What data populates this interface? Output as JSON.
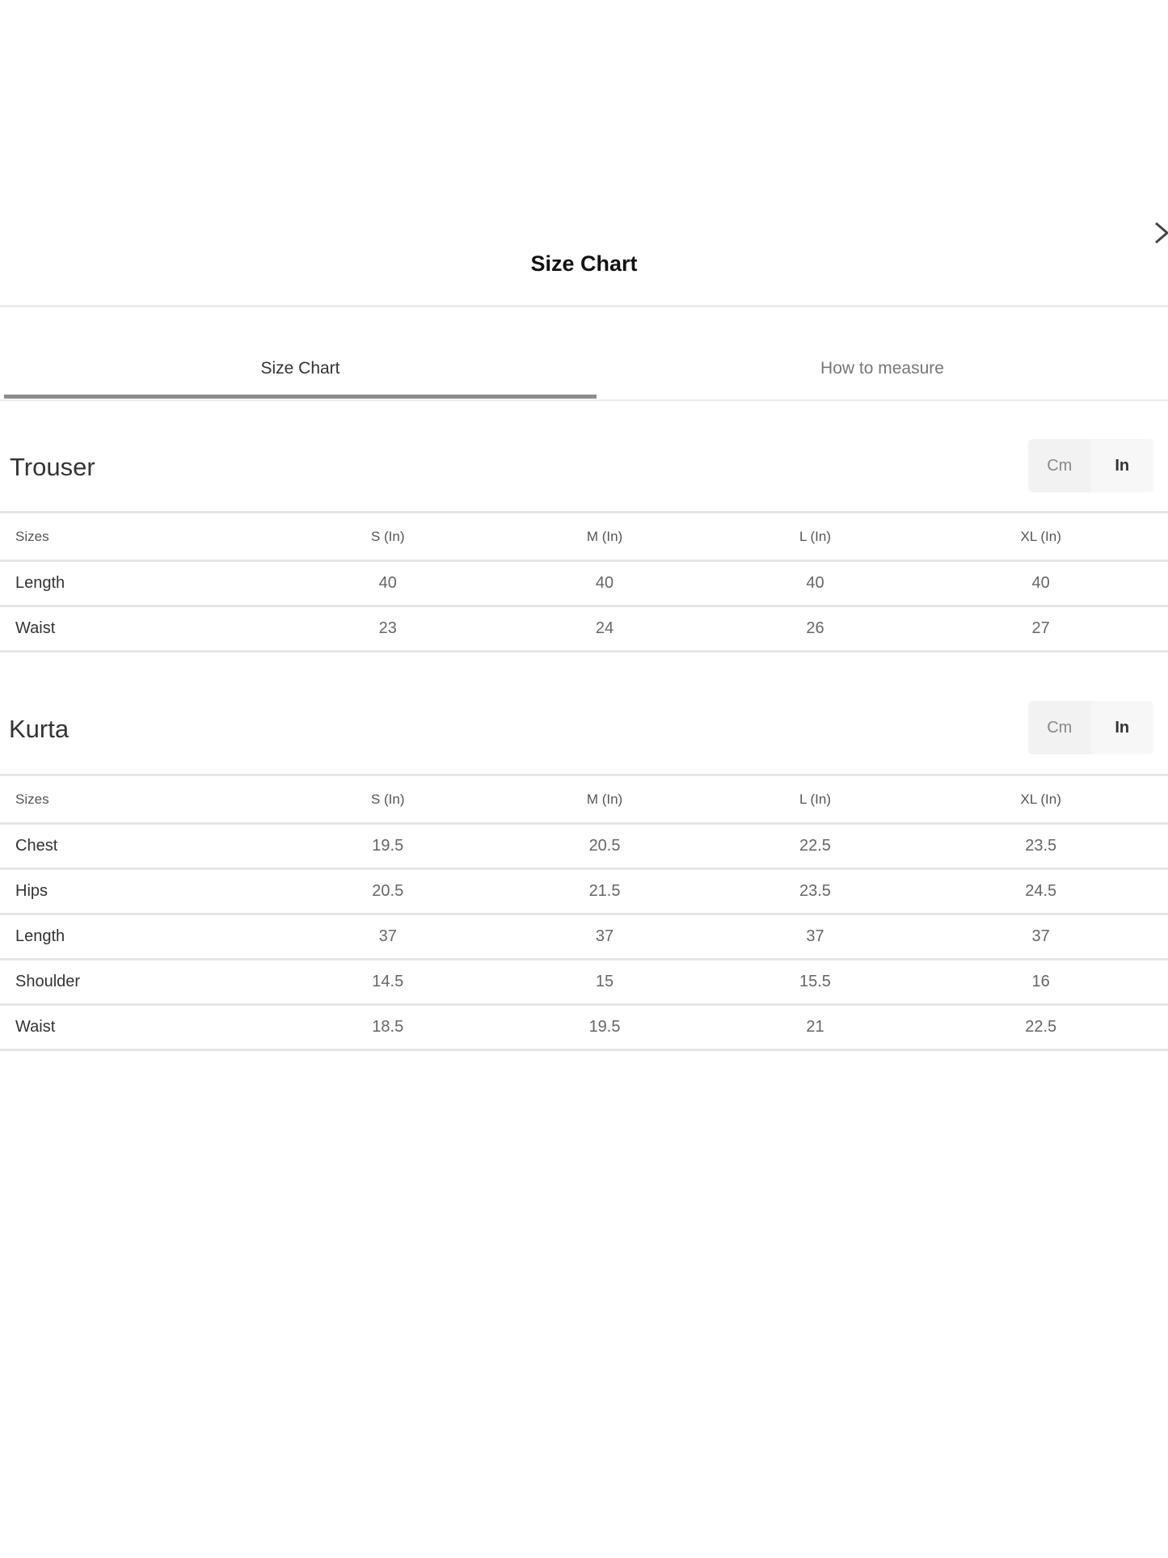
{
  "modal": {
    "title": "Size Chart"
  },
  "tabs": [
    {
      "label": "Size Chart",
      "active": true
    },
    {
      "label": "How to measure",
      "active": false
    }
  ],
  "units": {
    "cm": "Cm",
    "in": "In",
    "selected": "In"
  },
  "sections": [
    {
      "title": "Trouser",
      "headers": [
        "Sizes",
        "S (In)",
        "M (In)",
        "L (In)",
        "XL (In)"
      ],
      "rows": [
        {
          "label": "Length",
          "values": [
            "40",
            "40",
            "40",
            "40"
          ]
        },
        {
          "label": "Waist",
          "values": [
            "23",
            "24",
            "26",
            "27"
          ]
        }
      ]
    },
    {
      "title": "Kurta",
      "headers": [
        "Sizes",
        "S (In)",
        "M (In)",
        "L (In)",
        "XL (In)"
      ],
      "rows": [
        {
          "label": "Chest",
          "values": [
            "19.5",
            "20.5",
            "22.5",
            "23.5"
          ]
        },
        {
          "label": "Hips",
          "values": [
            "20.5",
            "21.5",
            "23.5",
            "24.5"
          ]
        },
        {
          "label": "Length",
          "values": [
            "37",
            "37",
            "37",
            "37"
          ]
        },
        {
          "label": "Shoulder",
          "values": [
            "14.5",
            "15",
            "15.5",
            "16"
          ]
        },
        {
          "label": "Waist",
          "values": [
            "18.5",
            "19.5",
            "21",
            "22.5"
          ]
        }
      ]
    }
  ],
  "icons": {
    "close": "close-chevron-icon"
  }
}
